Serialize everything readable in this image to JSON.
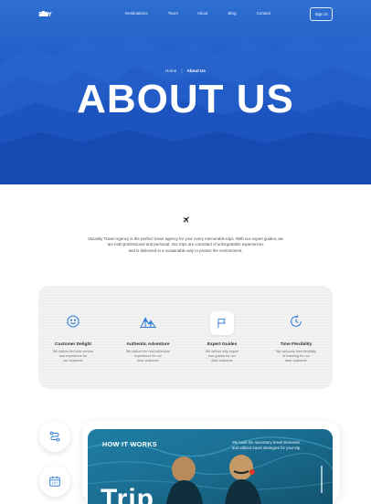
{
  "brand": {
    "logo_text": "SKY"
  },
  "nav": {
    "items": [
      "Destinations",
      "Tours",
      "About",
      "Blog",
      "Contact"
    ],
    "signin_label": "Sign in"
  },
  "breadcrumb": {
    "home": "Home",
    "separator": "|",
    "current": "About Us"
  },
  "hero": {
    "title": "ABOUT US"
  },
  "intro": {
    "line1": "Vacasky Travel Agency is the perfect travel agency for your every memorable trips. With our expert guides, we",
    "line2": "are both professional and personal. Our trips are consisted of unforgettable experiences",
    "line3": "and is delivered in a sustainable way to protect the environment."
  },
  "features": [
    {
      "icon": "smile-icon",
      "title": "Customer Delight",
      "desc1": "We deliver the best service",
      "desc2": "and experience for",
      "desc3": "our customer"
    },
    {
      "icon": "mountains-icon",
      "title": "Authentic Adventure",
      "desc1": "We deliver the real adventure",
      "desc2": "experience for our",
      "desc3": "dear customer"
    },
    {
      "icon": "flag-icon",
      "title": "Expert Guides",
      "desc1": "We deliver only expert",
      "desc2": "tour guides for our",
      "desc3": "dear customer"
    },
    {
      "icon": "clock-icon",
      "title": "Time Flexibility",
      "desc1": "We welcome time flexibility",
      "desc2": "of traveling for our",
      "desc3": "dear customer"
    }
  ],
  "how": {
    "title": "HOW IT WORKS",
    "text1": "We book the necessary travel itineraries",
    "text2": "and utilized travel strategies for your trip.",
    "big_word": "Trip"
  },
  "colors": {
    "primary": "#1d59c4",
    "accent": "#2d7ad6",
    "text": "#2c2f36"
  }
}
